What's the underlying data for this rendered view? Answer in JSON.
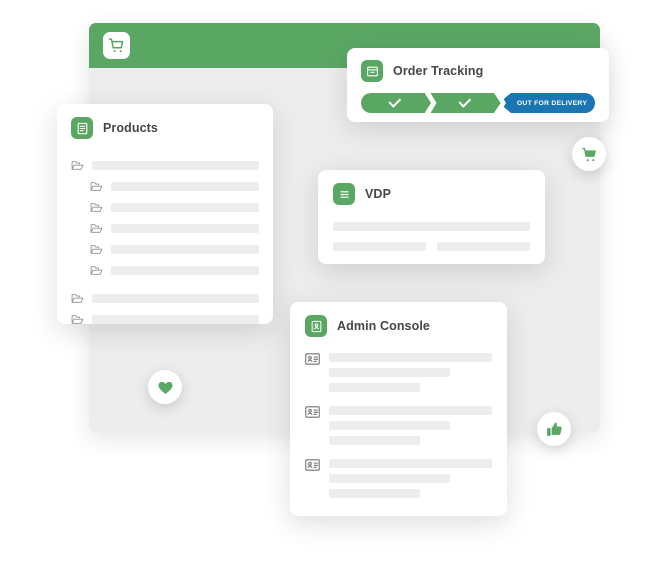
{
  "theme": {
    "brand_green": "#5aa763",
    "status_blue": "#1a75b3",
    "skeleton_gray": "#ededed",
    "window_body_gray": "#ededed",
    "title_text": "#44474a",
    "page_background": "#ffffff"
  },
  "main_window": {
    "header_icon": "shopping-cart-icon"
  },
  "order_tracking": {
    "title": "Order Tracking",
    "icon": "package-box-icon",
    "steps": [
      {
        "label": "",
        "state": "complete",
        "icon": "check-icon"
      },
      {
        "label": "",
        "state": "complete",
        "icon": "check-icon"
      },
      {
        "label": "OUT FOR DELIVERY",
        "state": "current",
        "icon": ""
      }
    ]
  },
  "products": {
    "title": "Products",
    "icon": "document-icon",
    "tree": [
      {
        "icon": "folder-icon",
        "indent": 0
      },
      {
        "icon": "folder-icon",
        "indent": 1
      },
      {
        "icon": "folder-icon",
        "indent": 1
      },
      {
        "icon": "folder-icon",
        "indent": 1
      },
      {
        "icon": "folder-icon",
        "indent": 1
      },
      {
        "icon": "folder-icon",
        "indent": 1
      },
      {
        "icon": "folder-icon",
        "indent": 0
      },
      {
        "icon": "folder-icon",
        "indent": 0
      }
    ]
  },
  "vdp": {
    "title": "VDP",
    "icon": "list-lines-icon",
    "rows": 1,
    "split_rows": 2
  },
  "admin_console": {
    "title": "Admin Console",
    "icon": "contact-card-icon",
    "groups": [
      {
        "icon": "contact-card-icon",
        "lines": 3
      },
      {
        "icon": "contact-card-icon",
        "lines": 3
      },
      {
        "icon": "contact-card-icon",
        "lines": 3
      }
    ]
  },
  "floating_buttons": [
    {
      "name": "cart-fab",
      "icon": "shopping-cart-icon"
    },
    {
      "name": "favorite-fab",
      "icon": "heart-icon"
    },
    {
      "name": "like-fab",
      "icon": "thumbs-up-icon"
    }
  ]
}
